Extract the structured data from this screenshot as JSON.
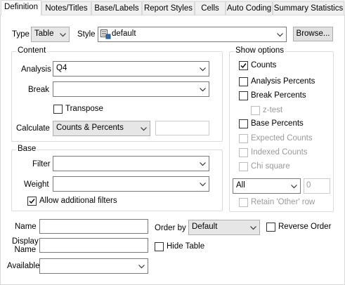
{
  "tabs": [
    "Definition",
    "Notes/Titles",
    "Base/Labels",
    "Report Styles",
    "Cells",
    "Auto Coding",
    "Summary Statistics"
  ],
  "top": {
    "type_label": "Type",
    "type_value": "Table",
    "style_label": "Style",
    "style_value": "default",
    "browse_label": "Browse..."
  },
  "content": {
    "title": "Content",
    "analysis_label": "Analysis",
    "analysis_value": "Q4",
    "break_label": "Break",
    "break_value": "",
    "transpose_label": "Transpose",
    "calculate_label": "Calculate",
    "calculate_value": "Counts & Percents"
  },
  "base": {
    "title": "Base",
    "filter_label": "Filter",
    "filter_value": "",
    "weight_label": "Weight",
    "weight_value": "",
    "allow_filters_label": "Allow additional filters"
  },
  "show_options": {
    "title": "Show options",
    "counts": "Counts",
    "analysis_percents": "Analysis Percents",
    "break_percents": "Break Percents",
    "z_test": "z-test",
    "base_percents": "Base Percents",
    "expected_counts": "Expected Counts",
    "indexed_counts": "Indexed Counts",
    "chi_square": "Chi square",
    "all_value": "All",
    "count_value": "0",
    "retain_other": "Retain 'Other' row"
  },
  "bottom": {
    "name_label": "Name",
    "name_value": "",
    "display_name_label_1": "Display",
    "display_name_label_2": "Name",
    "display_name_value": "",
    "available_label": "Available",
    "available_value": "",
    "order_by_label": "Order by",
    "order_by_value": "Default",
    "reverse_order_label": "Reverse Order",
    "hide_table_label": "Hide Table"
  }
}
